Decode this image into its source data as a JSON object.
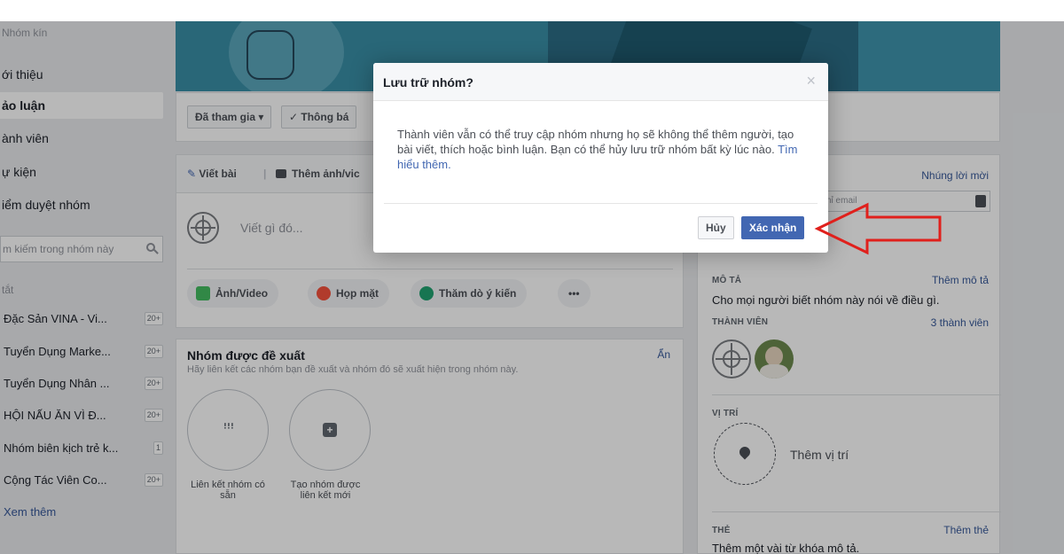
{
  "leftnav": {
    "top_label": "Nhóm kín",
    "items": [
      "ới thiệu",
      "ảo luận",
      "ành viên",
      "ự kiện",
      "iểm duyệt nhóm"
    ],
    "search_placeholder": "m kiếm trong nhóm này",
    "section_label": "tắt",
    "groups": [
      {
        "name": "Đặc Sản VINA - Vi...",
        "badge": "20+"
      },
      {
        "name": "Tuyển Dụng Marke...",
        "badge": "20+"
      },
      {
        "name": "Tuyển Dụng Nhân ...",
        "badge": "20+"
      },
      {
        "name": "HỘI NẤU ĂN VÌ Đ...",
        "badge": "20+"
      },
      {
        "name": "Nhóm biên kịch trẻ k...",
        "badge": "1"
      },
      {
        "name": "Cộng Tác Viên Co...",
        "badge": "20+"
      }
    ],
    "see_more": "Xem thêm"
  },
  "actionbar": {
    "joined": "Đã tham gia ▾",
    "notify": "✓ Thông bá"
  },
  "composer": {
    "tab_write": "Viết bài",
    "tab_photo": "Thêm ảnh/vic",
    "placeholder": "Viết gì đó...",
    "pill_photo": "Ảnh/Video",
    "pill_event": "Họp mặt",
    "pill_poll": "Thăm dò ý kiến",
    "pill_more": "•••"
  },
  "suggest": {
    "title": "Nhóm được đề xuất",
    "subtitle": "Hãy liên kết các nhóm bạn đề xuất và nhóm đó sẽ xuất hiện trong nhóm này.",
    "hide": "Ẩn",
    "link_existing": "Liên kết nhóm có sẵn",
    "create_new": "Tạo nhóm được liên kết mới"
  },
  "rightcol": {
    "invite_link": "Nhúng lời mời",
    "invite_placeholder": "hỉ email",
    "desc_head": "MÔ TẢ",
    "desc_link": "Thêm mô tả",
    "desc_text": "Cho mọi người biết nhóm này nói về điều gì.",
    "members_head": "THÀNH VIÊN",
    "members_count": "3 thành viên",
    "loc_head": "VỊ TRÍ",
    "loc_add": "Thêm vị trí",
    "tags_head": "THẺ",
    "tags_link": "Thêm thẻ",
    "tags_text": "Thêm một vài từ khóa mô tả."
  },
  "modal": {
    "title": "Lưu trữ nhóm?",
    "body": "Thành viên vẫn có thể truy cập nhóm nhưng họ sẽ không thể thêm người, tạo bài viết, thích hoặc bình luận. Bạn có thể hủy lưu trữ nhóm bất kỳ lúc nào.",
    "learn_more": "Tìm hiểu thêm.",
    "cancel": "Hủy",
    "confirm": "Xác nhận"
  },
  "colors": {
    "accent": "#4267b2",
    "link": "#365899",
    "arrow": "#e0201c"
  }
}
